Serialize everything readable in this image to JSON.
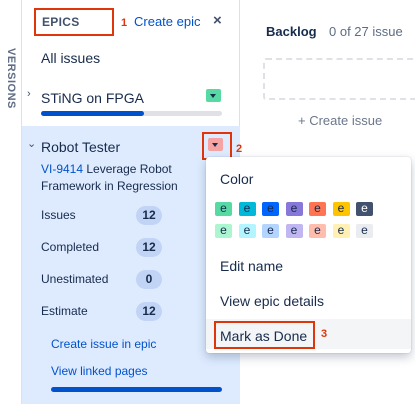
{
  "vertical_tab": {
    "label": "VERSIONS"
  },
  "epic_panel": {
    "header_label": "EPICS",
    "create_epic_label": "Create epic",
    "close_glyph": "×",
    "all_issues_label": "All issues",
    "epics": [
      {
        "name": "STiNG on FPGA",
        "color": "#57d9a3",
        "progress_fraction": 0.57
      }
    ],
    "selected_epic": {
      "name": "Robot Tester",
      "color": "#f5a3a3",
      "issue_key": "VI-9414",
      "issue_summary": "Leverage Robot Framework in Regression",
      "stats": [
        {
          "label": "Issues",
          "value": "12"
        },
        {
          "label": "Completed",
          "value": "12"
        },
        {
          "label": "Unestimated",
          "value": "0"
        },
        {
          "label": "Estimate",
          "value": "12"
        }
      ],
      "create_issue_in_epic_label": "Create issue in epic",
      "view_linked_pages_label": "View linked pages",
      "progress_fraction": 1.0
    }
  },
  "backlog": {
    "title": "Backlog",
    "count_text": "0 of 27 issue",
    "create_issue_label": "+ Create issue"
  },
  "color_menu": {
    "heading": "Color",
    "swatch_glyph": "e",
    "swatch_rows": [
      [
        "#57d9a3",
        "#00b8d9",
        "#0065ff",
        "#8777d9",
        "#ff7452",
        "#ffc400",
        "#42526e"
      ],
      [
        "#abf5d1",
        "#b3f5ff",
        "#b3d4ff",
        "#c0b6f2",
        "#ffbdad",
        "#fff0b3",
        "#ebecf0"
      ]
    ],
    "swatch_text_colors": [
      [
        "#172b4d",
        "#172b4d",
        "#172b4d",
        "#172b4d",
        "#172b4d",
        "#172b4d",
        "#ffffff"
      ],
      [
        "#172b4d",
        "#172b4d",
        "#172b4d",
        "#172b4d",
        "#172b4d",
        "#172b4d",
        "#172b4d"
      ]
    ],
    "items": [
      "Edit name",
      "View epic details",
      "Mark as Done"
    ]
  },
  "annotations": {
    "box1": "1",
    "box2": "2",
    "box3": "3"
  },
  "colors": {
    "link": "#0052cc",
    "annotation": "#de350b",
    "selected_bg": "#deebff"
  }
}
